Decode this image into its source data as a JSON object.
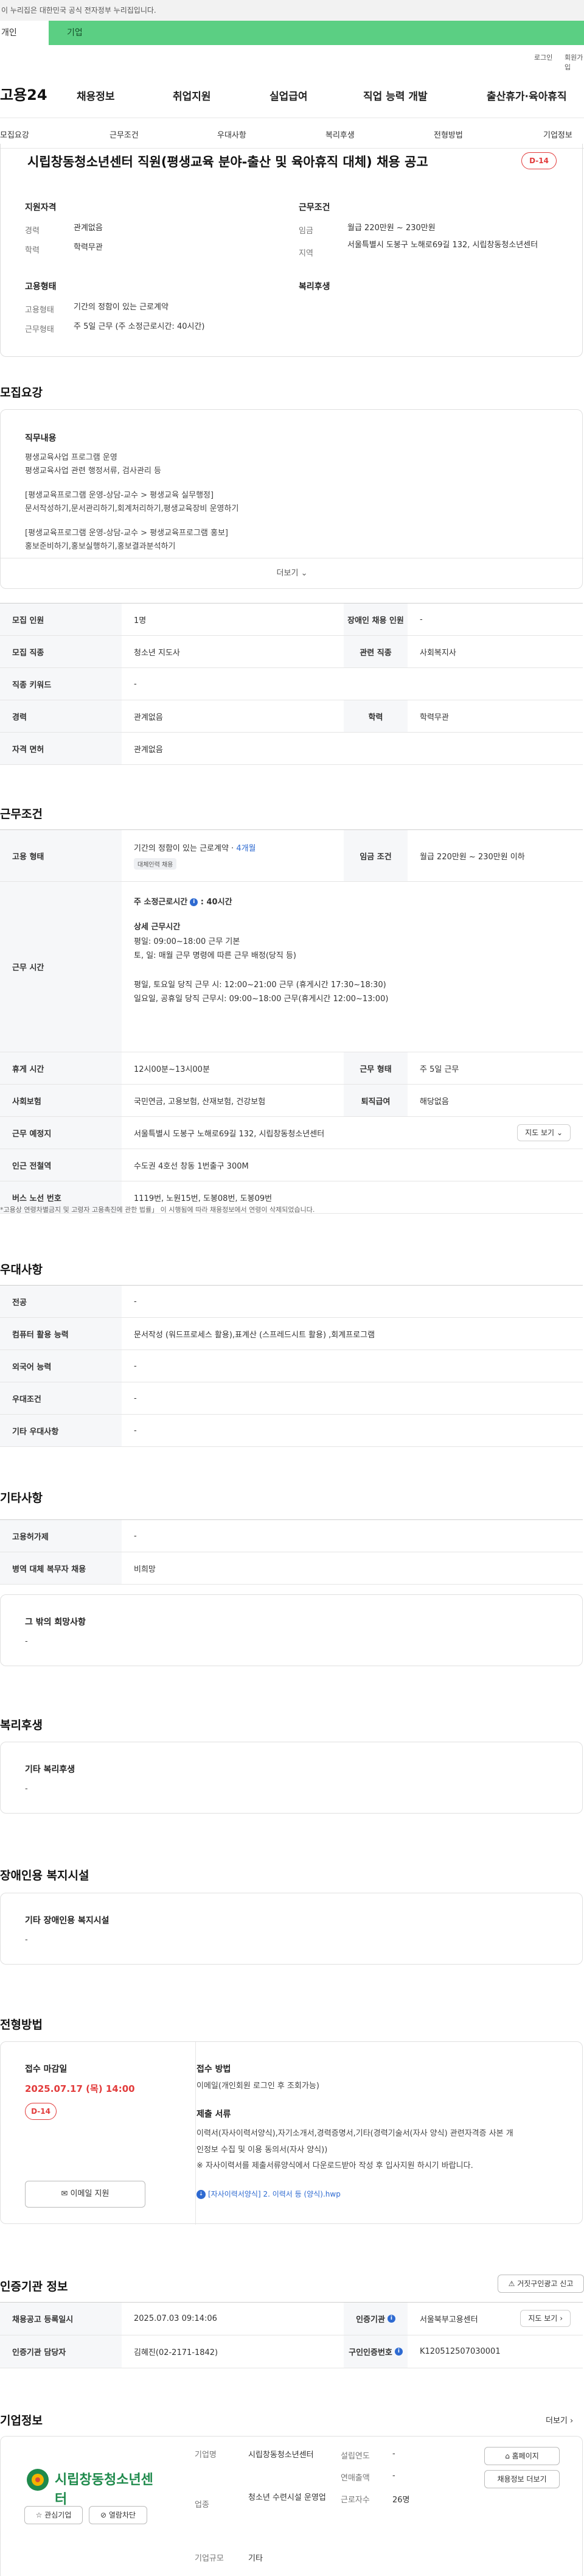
{
  "header": {
    "gov_notice": "이 누리집은 대한민국 공식 전자정부 누리집입니다.",
    "mode_tabs": [
      "개인",
      "기업"
    ],
    "util_links": [
      "로그인",
      "회원가입"
    ],
    "logo": "고용24",
    "gnb": [
      "채용정보",
      "취업지원",
      "실업급여",
      "직업 능력 개발",
      "출산휴가·육아휴직"
    ]
  },
  "anchors": [
    "모집요강",
    "근무조건",
    "우대사항",
    "복리후생",
    "전형방법",
    "기업정보"
  ],
  "summary": {
    "title": "시립창동청소년센터 직원(평생교육 분야-출산 및 육아휴직 대체) 채용 공고",
    "dday": "D-14",
    "qualification": {
      "heading": "지원자격",
      "career_label": "경력",
      "career_value": "관계없음",
      "edu_label": "학력",
      "edu_value": "학력무관"
    },
    "work": {
      "heading": "근무조건",
      "wage_label": "임금",
      "wage_value": "월급 220만원 ~ 230만원",
      "region_label": "지역",
      "region_value": "서울특별시 도봉구 노해로69길 132, 시립창동청소년센터"
    },
    "employment": {
      "heading": "고용형태",
      "type_label": "고용형태",
      "type_value": "기간의 정함이 있는 근로계약",
      "form_label": "근무형태",
      "form_value": "주 5일 근무 (주 소정근로시간: 40시간)"
    },
    "welfare": {
      "heading": "복리후생"
    }
  },
  "recruit": {
    "title": "모집요강",
    "duty_heading": "직무내용",
    "duty_lines": [
      "평생교육사업 프로그램 운영",
      "평생교육사업 관련 행정서류, 검사관리 등",
      "",
      "[평생교육프로그램 운영-상담-교수 > 평생교육 실무행정]",
      "문서작성하기,문서관리하기,회계처리하기,평생교육장비 운영하기",
      "",
      "[평생교육프로그램 운영-상담-교수 > 평생교육프로그램 홍보]",
      "홍보준비하기,홍보실행하기,홍보결과분석하기"
    ],
    "more": "더보기",
    "rows": [
      {
        "l1": "모집 인원",
        "v1": "1명",
        "l2": "장애인 채용 인원",
        "v2": "-"
      },
      {
        "l1": "모집 직종",
        "v1": "청소년 지도사",
        "l2": "관련 직종",
        "v2": "사회복지사"
      },
      {
        "l1": "직종 키워드",
        "v1": "-"
      },
      {
        "l1": "경력",
        "v1": "관계없음",
        "l2": "학력",
        "v2": "학력무관"
      },
      {
        "l1": "자격 면허",
        "v1": "관계없음"
      }
    ]
  },
  "conditions": {
    "title": "근무조건",
    "employment_label": "고용 형태",
    "employment_value": "기간의 정함이 있는 근로계약",
    "employment_period": "4개월",
    "employment_chip": "대체인력 채용",
    "wage_label": "임금 조건",
    "wage_value": "월급 220만원 ~ 230만원 이하",
    "hours_label": "근무 시간",
    "hours_weekly": "주 소정근로시간",
    "hours_weekly_value": "40시간",
    "hours_detail_heading": "상세 근무시간",
    "hours_lines": [
      "평일: 09:00~18:00 근무 기본",
      "토, 일: 매월 근무 명령에 따른 근무 배정(당직 등)",
      "",
      "평일, 토요일 당직 근무 시: 12:00~21:00 근무 (휴게시간 17:30~18:30)",
      "일요일, 공휴일 당직 근무시: 09:00~18:00 근무(휴게시간 12:00~13:00)"
    ],
    "break_label": "휴게 시간",
    "break_value": "12시00분~13시00분",
    "form_label": "근무 형태",
    "form_value": "주 5일 근무",
    "insurance_label": "사회보험",
    "insurance_value": "국민연금, 고용보험, 산재보험, 건강보험",
    "severance_label": "퇴직급여",
    "severance_value": "해당없음",
    "place_label": "근무 예정지",
    "place_value": "서울특별시 도봉구 노해로69길 132, 시립창동청소년센터",
    "map_button": "지도 보기",
    "subway_label": "인근 전철역",
    "subway_value": "수도권 4호선 창동 1번출구 300M",
    "bus_label": "버스 노선 번호",
    "bus_value": "1119번, 노원15번, 도봉08번, 도봉09번",
    "note": "*고용상 연령차별금지 및 고령자 고용촉진에 관한 법률」 이 시행됨에 따라 채용정보에서 연령이 삭제되었습니다."
  },
  "preference": {
    "title": "우대사항",
    "rows": [
      {
        "l": "전공",
        "v": "-"
      },
      {
        "l": "컴퓨터 활용 능력",
        "v": "문서작성 (워드프로세스 활용),표계산 (스프레드시트 활용) ,회계프로그램"
      },
      {
        "l": "외국어 능력",
        "v": "-"
      },
      {
        "l": "우대조건",
        "v": "-"
      },
      {
        "l": "기타 우대사항",
        "v": "-"
      }
    ]
  },
  "etc": {
    "title": "기타사항",
    "rows": [
      {
        "l": "고용허가제",
        "v": "-"
      },
      {
        "l": "병역 대체 복무자 채용",
        "v": "비희망"
      }
    ],
    "other_heading": "그 밖의 희망사항",
    "other_value": "-"
  },
  "welfare": {
    "title": "복리후생",
    "heading": "기타 복리후생",
    "value": "-"
  },
  "disability": {
    "title": "장애인용 복지시설",
    "heading": "기타 장애인용 복지시설",
    "value": "-"
  },
  "process": {
    "title": "전형방법",
    "deadline_heading": "접수 마감일",
    "deadline_value": "2025.07.17 (목) 14:00",
    "dday": "D-14",
    "email_button": "이메일 지원",
    "method_heading": "접수 방법",
    "method_value": "이메일(개인회원 로그인 후 조회가능)",
    "docs_heading": "제출 서류",
    "docs_lines": [
      "이력서(자사이력서양식),자기소개서,경력증명서,기타(경력기술서(자사 양식) 관련자격증 사본 개",
      "인정보 수집 및 이용 동의서(자사 양식))",
      "※ 자사이력서를 제출서류양식에서 다운로드받아 작성 후 입사지원 하시기 바랍니다."
    ],
    "attach_link": "[자사이력서양식] 2. 이력서 등 (양식).hwp"
  },
  "agency": {
    "title": "인증기관 정보",
    "report_button": "거짓구인광고 신고",
    "reg_label": "채용공고 등록일시",
    "reg_value": "2025.07.03 09:14:06",
    "org_label": "인증기관",
    "org_value": "서울북부고용센터",
    "map_button": "지도 보기",
    "manager_label": "인증기관 담당자",
    "manager_value": "김혜진(02-2171-1842)",
    "num_label": "구인인증번호",
    "num_value": "K120512507030001"
  },
  "company": {
    "title": "기업정보",
    "more": "더보기",
    "logo_text": "시립창동청소년센터",
    "like_button": "관심기업",
    "block_button": "열람차단",
    "name_label": "기업명",
    "name_value": "시립창동청소년센터",
    "industry_label": "업종",
    "industry_value": "청소년 수련시설 운영업",
    "size_label": "기업규모",
    "size_value": "기타",
    "founded_label": "설립연도",
    "founded_value": "-",
    "sales_label": "연매출액",
    "sales_value": "-",
    "staff_label": "근로자수",
    "staff_value": "26명",
    "home_button": "홈페이지",
    "jobs_button": "채용정보 더보기"
  }
}
